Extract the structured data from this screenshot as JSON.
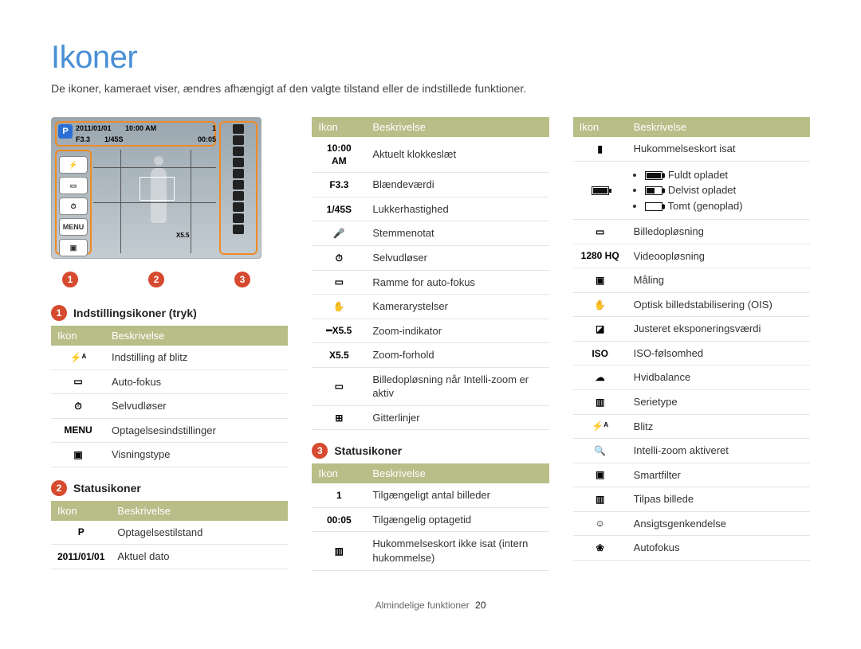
{
  "page": {
    "title": "Ikoner",
    "subtitle": "De ikoner, kameraet viser, ændres afhængigt af den valgte tilstand eller de indstillede funktioner.",
    "footer_label": "Almindelige funktioner",
    "footer_page": "20"
  },
  "display": {
    "mode_badge": "P",
    "date": "2011/01/01",
    "time": "10:00 AM",
    "aperture": "F3.3",
    "shutter": "1/45S",
    "rec_time": "00:05",
    "shots": "1",
    "zoom_ratio": "X5.5",
    "menu_label": "MENU"
  },
  "markers": {
    "m1": "1",
    "m2": "2",
    "m3": "3"
  },
  "headers": {
    "icon": "Ikon",
    "desc": "Beskrivelse"
  },
  "section1": {
    "title": "Indstillingsikoner (tryk)",
    "rows": [
      {
        "icon_name": "flash-auto-icon",
        "icon_text": "⚡ᴬ",
        "desc": "Indstilling af blitz"
      },
      {
        "icon_name": "autofocus-mode-icon",
        "icon_text": "▭",
        "desc": "Auto-fokus"
      },
      {
        "icon_name": "selftimer-icon",
        "icon_text": "⏱",
        "desc": "Selvudløser"
      },
      {
        "icon_name": "menu-icon",
        "icon_text": "MENU",
        "desc": "Optagelsesindstillinger"
      },
      {
        "icon_name": "display-type-icon",
        "icon_text": "▣",
        "desc": "Visningstype"
      }
    ]
  },
  "section2": {
    "title": "Statusikoner",
    "rows": [
      {
        "icon_name": "mode-p-icon",
        "icon_text": "P",
        "desc": "Optagelsestilstand"
      },
      {
        "icon_name": "date-text",
        "icon_text": "2011/01/01",
        "desc": "Aktuel dato"
      }
    ]
  },
  "section2b": {
    "rows": [
      {
        "icon_name": "time-text",
        "icon_text": "10:00 AM",
        "desc": "Aktuelt klokkeslæt"
      },
      {
        "icon_name": "aperture-text",
        "icon_text": "F3.3",
        "desc": "Blændeværdi"
      },
      {
        "icon_name": "shutter-text",
        "icon_text": "1/45S",
        "desc": "Lukkerhastighed"
      },
      {
        "icon_name": "voice-memo-icon",
        "icon_text": "🎤",
        "desc": "Stemmenotat"
      },
      {
        "icon_name": "selftimer2-icon",
        "icon_text": "⏱",
        "desc": "Selvudløser"
      },
      {
        "icon_name": "af-frame-icon",
        "icon_text": "▭",
        "desc": "Ramme for auto-fokus"
      },
      {
        "icon_name": "camera-shake-icon",
        "icon_text": "✋",
        "desc": "Kamerarystelser"
      },
      {
        "icon_name": "zoom-indicator-icon",
        "icon_text": "━X5.5",
        "desc": "Zoom-indikator"
      },
      {
        "icon_name": "zoom-ratio-text",
        "icon_text": "X5.5",
        "desc": "Zoom-forhold"
      },
      {
        "icon_name": "intelli-zoom-res-icon",
        "icon_text": "▭",
        "desc": "Billedopløsning når Intelli-zoom er aktiv"
      },
      {
        "icon_name": "gridlines-icon",
        "icon_text": "⊞",
        "desc": "Gitterlinjer"
      }
    ]
  },
  "section3": {
    "title": "Statusikoner",
    "rows": [
      {
        "icon_name": "shots-remaining-text",
        "icon_text": "1",
        "desc": "Tilgængeligt antal billeder"
      },
      {
        "icon_name": "rec-time-text",
        "icon_text": "00:05",
        "desc": "Tilgængelig optagetid"
      },
      {
        "icon_name": "internal-memory-icon",
        "icon_text": "▥",
        "desc": "Hukommelseskort ikke isat (intern hukommelse)"
      }
    ]
  },
  "section3b": {
    "rows_top": [
      {
        "icon_name": "memory-card-icon",
        "icon_text": "▮",
        "desc": "Hukommelseskort isat"
      }
    ],
    "battery": {
      "icon_name": "battery-icon",
      "full": ": Fuldt opladet",
      "partial": ": Delvist opladet",
      "empty": ": Tomt (genoplad)"
    },
    "rows_cont": [
      {
        "icon_name": "image-res-icon",
        "icon_text": "▭",
        "desc": "Billedopløsning"
      },
      {
        "icon_name": "video-res-icon",
        "icon_text": "1280 HQ",
        "desc": "Videoopløsning"
      },
      {
        "icon_name": "metering-icon",
        "icon_text": "▣",
        "desc": "Måling"
      },
      {
        "icon_name": "ois-icon",
        "icon_text": "✋",
        "desc": "Optisk billedstabilisering (OIS)"
      },
      {
        "icon_name": "ev-adjust-icon",
        "icon_text": "◪",
        "desc": "Justeret eksponeringsværdi"
      },
      {
        "icon_name": "iso-icon",
        "icon_text": "ISO",
        "desc": "ISO-følsomhed"
      },
      {
        "icon_name": "white-balance-icon",
        "icon_text": "☁",
        "desc": "Hvidbalance"
      },
      {
        "icon_name": "burst-icon",
        "icon_text": "▥",
        "desc": "Serietype"
      },
      {
        "icon_name": "flash-icon",
        "icon_text": "⚡ᴬ",
        "desc": "Blitz"
      },
      {
        "icon_name": "intelli-zoom-icon",
        "icon_text": "🔍",
        "desc": "Intelli-zoom aktiveret"
      },
      {
        "icon_name": "smart-filter-icon",
        "icon_text": "▣",
        "desc": "Smartfilter"
      },
      {
        "icon_name": "image-adjust-icon",
        "icon_text": "▥",
        "desc": "Tilpas billede"
      },
      {
        "icon_name": "face-detect-icon",
        "icon_text": "☺",
        "desc": "Ansigtsgenkendelse"
      },
      {
        "icon_name": "macro-icon",
        "icon_text": "❀",
        "desc": "Autofokus"
      }
    ]
  }
}
